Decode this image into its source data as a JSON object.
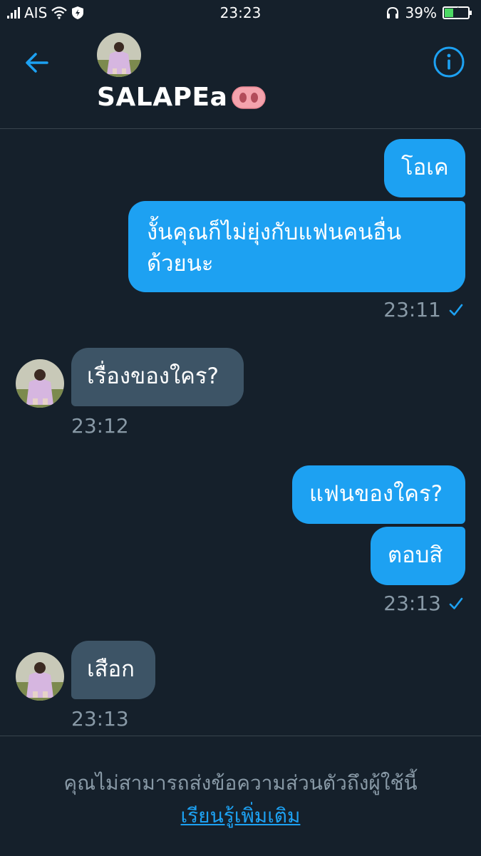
{
  "status_bar": {
    "carrier": "AIS",
    "time": "23:23",
    "battery_percent": "39%",
    "battery_level": 0.39
  },
  "header": {
    "name": "SALAPEa",
    "back_icon": "arrow-left-icon",
    "info_icon": "info-icon"
  },
  "conversation": {
    "group1": {
      "messages": [
        "โอเค",
        "งั้นคุณก็ไม่ยุ่งกับแฟนคนอื่น",
        "ด้วยนะ"
      ],
      "time": "23:11"
    },
    "group2": {
      "message": "เรื่องของใคร?",
      "time": "23:12"
    },
    "group3": {
      "messages": [
        "แฟนของใคร?",
        "ตอบสิ"
      ],
      "time": "23:13"
    },
    "group4": {
      "message": "เสือก",
      "time": "23:13"
    }
  },
  "footer": {
    "note": "คุณไม่สามารถส่งข้อความส่วนตัวถึงผู้ใช้นี้",
    "link": "เรียนรู้เพิ่มเติม"
  },
  "colors": {
    "background": "#15202b",
    "accent": "#1da1f2",
    "received_bubble": "#3d5466",
    "muted_text": "#8899a6",
    "divider": "#38444d"
  }
}
